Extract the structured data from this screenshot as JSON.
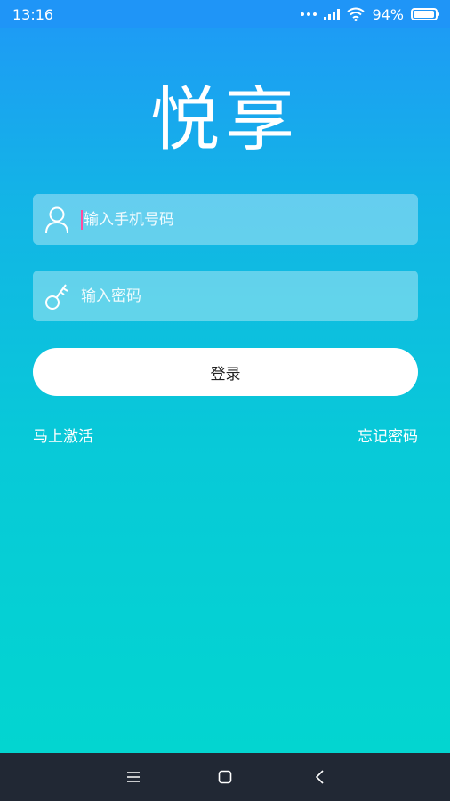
{
  "status_bar": {
    "time": "13:16",
    "battery": "94%",
    "battery_level": 0.94
  },
  "logo": {
    "text": "悦享"
  },
  "phone_field": {
    "placeholder": "输入手机号码",
    "icon": "user-icon"
  },
  "password_field": {
    "placeholder": "输入密码",
    "icon": "key-icon"
  },
  "login_button": {
    "label": "登录"
  },
  "links": {
    "activate": "马上激活",
    "forgot_password": "忘记密码"
  },
  "nav_bar": {
    "menu_icon": "menu-icon",
    "home_icon": "home-icon",
    "back_icon": "back-icon"
  },
  "colors": {
    "gradient_top": "#1f98f7",
    "gradient_bottom": "#02d7cf",
    "caret": "#ff4aa0",
    "nav_bar": "#212834"
  }
}
